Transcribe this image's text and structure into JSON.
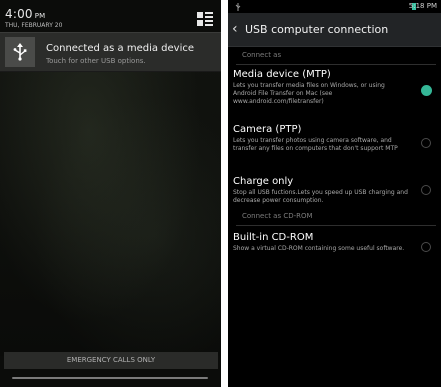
{
  "left_screen": {
    "clock": {
      "time": "4:00",
      "ampm": "PM"
    },
    "date": "THU, FEBRUARY 20",
    "notification": {
      "title": "Connected as a media device",
      "subtitle": "Touch for other USB options."
    },
    "emergency_label": "EMERGENCY CALLS ONLY",
    "icons": [
      "settings-icon",
      "usb-icon"
    ]
  },
  "right_screen": {
    "status_time": "5:18 PM",
    "header_title": "USB computer connection",
    "section_connect_as": "Connect as",
    "section_cdrom": "Connect as CD-ROM",
    "options": [
      {
        "title": "Media device (MTP)",
        "desc": "Lets you transfer media files on Windows, or using Android File Transfer on Mac (see www.android.com/filetransfer)",
        "selected": true
      },
      {
        "title": "Camera (PTP)",
        "desc": "Lets you transfer photos using camera software, and transfer any files on computers that don't support MTP",
        "selected": false
      },
      {
        "title": "Charge only",
        "desc": "Stop all USB fuctions.Lets you speed up USB charging and decrease power consumption.",
        "selected": false
      },
      {
        "title": "Built-in CD-ROM",
        "desc": "Show a virtual CD-ROM containing some useful software.",
        "selected": false
      }
    ],
    "colors": {
      "accent": "#35b797",
      "header_bg": "#222426"
    }
  }
}
